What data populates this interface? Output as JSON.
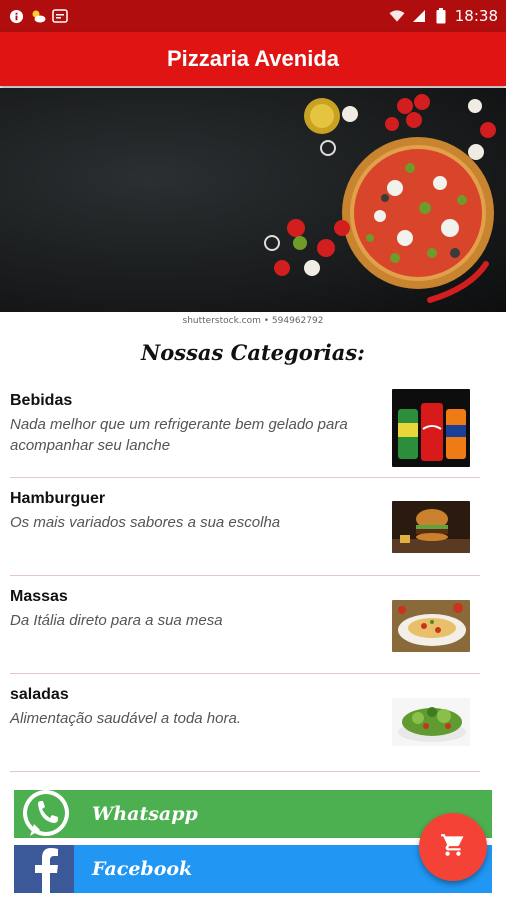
{
  "status_bar": {
    "time": "18:38",
    "left_icons": [
      "info-icon",
      "weather-icon",
      "notification-icon"
    ],
    "right_icons": [
      "wifi-icon",
      "signal-icon",
      "battery-icon"
    ]
  },
  "app_bar": {
    "title": "Pizzaria Avenida"
  },
  "hero": {
    "watermark": "shutterstock.com • 594962792"
  },
  "section": {
    "title": "Nossas Categorias:"
  },
  "categories": [
    {
      "name": "Bebidas",
      "description": "Nada melhor que um refrigerante bem gelado para acompanhar seu lanche",
      "thumb": "soda-cans-image"
    },
    {
      "name": "Hamburguer",
      "description": "Os mais variados sabores a sua escolha",
      "thumb": "hamburger-image"
    },
    {
      "name": "Massas",
      "description": "Da Itália direto para a sua mesa",
      "thumb": "pasta-image"
    },
    {
      "name": "saladas",
      "description": "Alimentação saudável a toda hora.",
      "thumb": "salad-image"
    }
  ],
  "social": {
    "whatsapp_label": "Whatsapp",
    "facebook_label": "Facebook"
  },
  "fab": {
    "icon": "cart-icon"
  },
  "colors": {
    "status_bar": "#b00e0e",
    "app_bar": "#e11414",
    "whatsapp": "#4caf50",
    "facebook": "#2196f3",
    "fab": "#f44336"
  }
}
